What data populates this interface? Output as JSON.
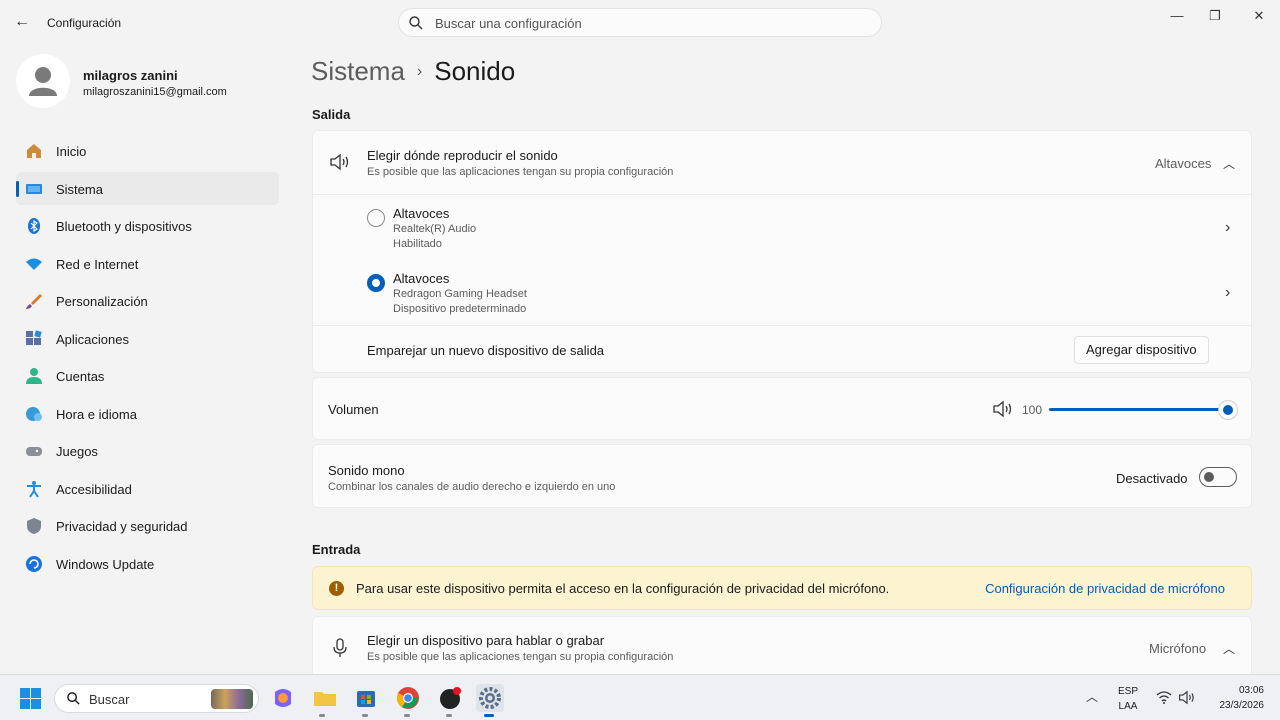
{
  "window": {
    "title": "Configuración",
    "search_placeholder": "Buscar una configuración"
  },
  "profile": {
    "name": "milagros zanini",
    "email": "milagroszanini15@gmail.com"
  },
  "sidebar": {
    "items": [
      {
        "label": "Inicio",
        "icon": "home-icon"
      },
      {
        "label": "Sistema",
        "icon": "system-icon",
        "active": true
      },
      {
        "label": "Bluetooth y dispositivos",
        "icon": "bluetooth-icon"
      },
      {
        "label": "Red e Internet",
        "icon": "wifi-icon"
      },
      {
        "label": "Personalización",
        "icon": "brush-icon"
      },
      {
        "label": "Aplicaciones",
        "icon": "apps-icon"
      },
      {
        "label": "Cuentas",
        "icon": "account-icon"
      },
      {
        "label": "Hora e idioma",
        "icon": "globe-clock-icon"
      },
      {
        "label": "Juegos",
        "icon": "gamepad-icon"
      },
      {
        "label": "Accesibilidad",
        "icon": "accessibility-icon"
      },
      {
        "label": "Privacidad y seguridad",
        "icon": "shield-icon"
      },
      {
        "label": "Windows Update",
        "icon": "update-icon"
      }
    ]
  },
  "breadcrumb": {
    "parent": "Sistema",
    "separator": "›",
    "current": "Sonido"
  },
  "output": {
    "section_title": "Salida",
    "choose": {
      "title": "Elegir dónde reproducir el sonido",
      "subtitle": "Es posible que las aplicaciones tengan su propia configuración",
      "value": "Altavoces"
    },
    "devices": [
      {
        "name": "Altavoces",
        "line1": "Realtek(R) Audio",
        "line2": "Habilitado",
        "selected": false
      },
      {
        "name": "Altavoces",
        "line1": "Redragon Gaming Headset",
        "line2": "Dispositivo predeterminado",
        "selected": true
      }
    ],
    "pair": {
      "label": "Emparejar un nuevo dispositivo de salida",
      "button": "Agregar dispositivo"
    },
    "volume": {
      "label": "Volumen",
      "value": "100",
      "level": 1.0
    },
    "mono": {
      "title": "Sonido mono",
      "subtitle": "Combinar los canales de audio derecho e izquierdo en uno",
      "state": "Desactivado"
    }
  },
  "input": {
    "section_title": "Entrada",
    "warning": {
      "text": "Para usar este dispositivo permita el acceso en la configuración de privacidad del micrófono.",
      "link": "Configuración de privacidad de micrófono"
    },
    "choose": {
      "title": "Elegir un dispositivo para hablar o grabar",
      "subtitle": "Es posible que las aplicaciones tengan su propia configuración",
      "value": "Micrófono"
    }
  },
  "taskbar": {
    "search_label": "Buscar",
    "apps": [
      "windows-start-icon",
      "copilot-icon",
      "file-explorer-icon",
      "store-icon",
      "chrome-icon",
      "app-icon",
      "settings-icon"
    ],
    "lang_top": "ESP",
    "lang_bottom": "LAA",
    "time": "03:06",
    "date": "23/3/2026"
  },
  "colors": {
    "accent": "#005fb8",
    "warning_bg": "#fcf3d0",
    "background": "#f3f3f3"
  }
}
